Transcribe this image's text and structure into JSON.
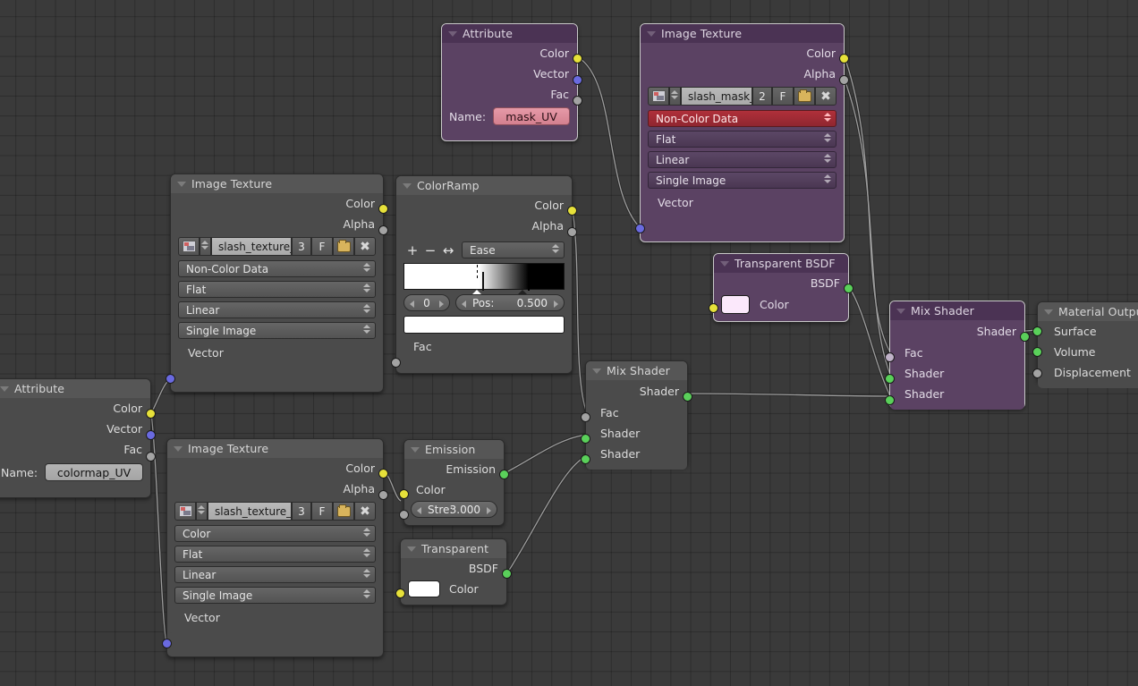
{
  "app": {
    "editor": "Blender Shader Node Editor"
  },
  "nodes": {
    "attribute_mask": {
      "title": "Attribute",
      "outputs": [
        "Color",
        "Vector",
        "Fac"
      ],
      "name_label": "Name:",
      "name_value": "mask_UV"
    },
    "image_texture_mask": {
      "title": "Image Texture",
      "outputs": [
        "Color",
        "Alpha"
      ],
      "image_name": "slash_mask_...",
      "users": "2",
      "fake_user": "F",
      "colorspace": "Non-Color Data",
      "projection": "Flat",
      "interpolation": "Linear",
      "extension": "Single Image",
      "inputs": [
        "Vector"
      ]
    },
    "image_texture_top": {
      "title": "Image Texture",
      "outputs": [
        "Color",
        "Alpha"
      ],
      "image_name": "slash_texture_...",
      "users": "3",
      "fake_user": "F",
      "colorspace": "Non-Color Data",
      "projection": "Flat",
      "interpolation": "Linear",
      "extension": "Single Image",
      "inputs": [
        "Vector"
      ]
    },
    "colorramp": {
      "title": "ColorRamp",
      "outputs": [
        "Color",
        "Alpha"
      ],
      "add_btn": "+",
      "remove_btn": "−",
      "flip_btn": "↔",
      "interpolation": "Ease",
      "index_value": "0",
      "pos_label": "Pos:",
      "pos_value": "0.500",
      "inputs": [
        "Fac"
      ]
    },
    "attribute_colormap": {
      "title": "Attribute",
      "outputs": [
        "Color",
        "Vector",
        "Fac"
      ],
      "name_label": "Name:",
      "name_value": "colormap_UV"
    },
    "image_texture_bottom": {
      "title": "Image Texture",
      "outputs": [
        "Color",
        "Alpha"
      ],
      "image_name": "slash_texture_O...",
      "users": "3",
      "fake_user": "F",
      "colorspace": "Color",
      "projection": "Flat",
      "interpolation": "Linear",
      "extension": "Single Image",
      "inputs": [
        "Vector"
      ]
    },
    "emission": {
      "title": "Emission",
      "outputs": [
        "Emission"
      ],
      "inputs": [
        "Color"
      ],
      "strength_label": "Stre:",
      "strength_value": "3.000"
    },
    "transparent_bsdf_small": {
      "title": "Transparent B...",
      "outputs": [
        "BSDF"
      ],
      "inputs": [
        "Color"
      ],
      "color_swatch": "#ffffff"
    },
    "transparent_bsdf_big": {
      "title": "Transparent BSDF",
      "outputs": [
        "BSDF"
      ],
      "inputs": [
        "Color"
      ],
      "color_swatch": "#fbe8fb"
    },
    "mix_shader_mid": {
      "title": "Mix Shader",
      "outputs": [
        "Shader"
      ],
      "inputs": [
        "Fac",
        "Shader",
        "Shader"
      ]
    },
    "mix_shader_right": {
      "title": "Mix Shader",
      "outputs": [
        "Shader"
      ],
      "inputs": [
        "Fac",
        "Shader",
        "Shader"
      ]
    },
    "material_output": {
      "title": "Material Output",
      "inputs": [
        "Surface",
        "Volume",
        "Displacement"
      ]
    }
  },
  "colors": {
    "background": "#3a3a3a",
    "node_grey": "#4b4b4b",
    "node_purple": "#5b4263",
    "socket_color": "#e7e13a",
    "socket_vector": "#6a6ae0",
    "socket_value": "#a3a3a3",
    "socket_shader": "#5ad05a",
    "colorspace_warning": "#b0303a"
  }
}
